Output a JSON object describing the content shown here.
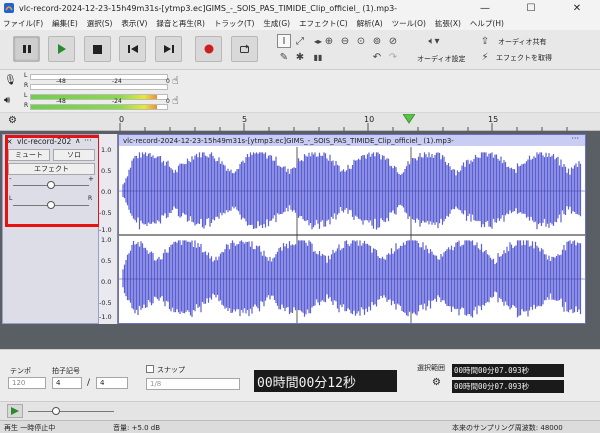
{
  "window": {
    "title": "vlc-record-2024-12-23-15h49m31s-[ytmp3.ec]GIMS_-_SOIS_PAS_TIMIDE_Clip_officiel_ (1).mp3-",
    "minimize": "—",
    "maximize": "☐",
    "close": "✕"
  },
  "menu": [
    "ファイル(F)",
    "編集(E)",
    "選択(S)",
    "表示(V)",
    "録音と再生(R)",
    "トラック(T)",
    "生成(G)",
    "エフェクト(C)",
    "解析(A)",
    "ツール(O)",
    "拡張(X)",
    "ヘルプ(H)"
  ],
  "toolbar": {
    "audio_setup_label": "オーディオ設定",
    "share_audio_label": "オーディオ共有",
    "get_effects_label": "エフェクトを取得"
  },
  "meters": {
    "rec_letters": [
      "L",
      "R"
    ],
    "rec_ticks": [
      "-48",
      "-24",
      "0"
    ],
    "play_letters": [
      "L",
      "R"
    ],
    "play_ticks": [
      "-48",
      "-24",
      "0"
    ],
    "play_level_left": 0.93,
    "play_level_right": 0.93
  },
  "ruler": {
    "ticks": [
      "0",
      "5",
      "10",
      "15"
    ]
  },
  "track": {
    "name": "vlc-record-202",
    "collapse": "∧",
    "more": "···",
    "mute_label": "ミュート",
    "solo_label": "ソロ",
    "effects_label": "エフェクト",
    "gain_minus": "-",
    "gain_plus": "+",
    "pan_left": "L",
    "pan_right": "R",
    "gain_value": 0.5,
    "pan_value": 0.5,
    "clip_name": "vlc-record-2024-12-23-15h49m31s-[ytmp3.ec]GIMS_-_SOIS_PAS_TIMIDE_Clip_officiel_ (1).mp3-",
    "clip_more": "···",
    "scale_top": [
      "1.0",
      "0.5",
      "0.0",
      "-0.5",
      "-1.0"
    ],
    "scale_bottom": [
      "1.0",
      "0.5",
      "0.0",
      "-0.5",
      "-1.0"
    ]
  },
  "bottom": {
    "tempo_label": "テンポ",
    "tempo_value": "120",
    "timesig_label": "拍子記号",
    "timesig_num": "4",
    "timesig_sep": "/",
    "timesig_den": "4",
    "snap_label": "スナップ",
    "snap_value": "1/8",
    "time_display": "00時間00分12秒",
    "selection_label": "選択範囲",
    "selection_start": "00時間00分07.093秒",
    "selection_end": "00時間00分07.093秒"
  },
  "status": {
    "state": "再生 一時停止中",
    "volume": "音量: +5.0 dB",
    "sample_rate": "本来のサンプリング周波数: 48000"
  },
  "colors": {
    "wave": "#5b5fd4",
    "clip_header": "#c9cdf3",
    "highlight": "#e81010"
  }
}
